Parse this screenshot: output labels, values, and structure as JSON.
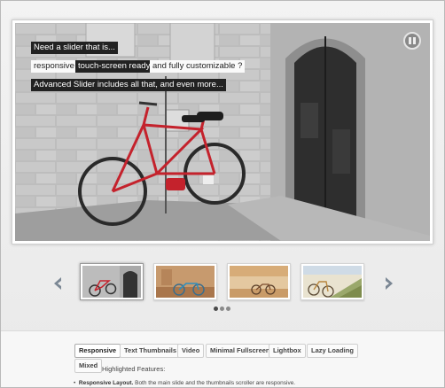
{
  "slider": {
    "captions": {
      "line1": "Need a slider that is...",
      "tag_responsive": "responsive",
      "tag_touch": "touch-screen ready",
      "tag_custom": "and fully customizable ?",
      "line3": "Advanced Slider includes all that, and even more..."
    },
    "pause_button": "pause-icon"
  },
  "thumbnails": {
    "items": [
      {
        "name": "thumb-red-bicycle",
        "active": true
      },
      {
        "name": "thumb-blue-bicycle",
        "active": false
      },
      {
        "name": "thumb-bicycle-wall",
        "active": false
      },
      {
        "name": "thumb-bicycle-grass",
        "active": false
      }
    ],
    "pagination_count": 3,
    "active_page": 0
  },
  "tabs": [
    {
      "label": "Responsive",
      "active": true
    },
    {
      "label": "Text Thumbnails",
      "active": false
    },
    {
      "label": "Video",
      "active": false
    },
    {
      "label": "Minimal Fullscreen",
      "active": false
    },
    {
      "label": "Lightbox",
      "active": false
    },
    {
      "label": "Lazy Loading",
      "active": false
    },
    {
      "label": "Mixed",
      "active": false
    }
  ],
  "features": {
    "title": "Highlighted Features:",
    "item1_bold": "Responsive Layout.",
    "item1_text": " Both the main slide and the thumbnails scroller are responsive."
  },
  "colors": {
    "accent_red": "#c4222c",
    "caption_dark": "#222222"
  }
}
